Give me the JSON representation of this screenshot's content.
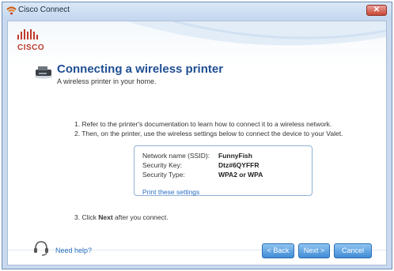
{
  "window": {
    "title": "Cisco Connect",
    "close_glyph": "✕"
  },
  "brand": {
    "logo_bars": "ılıılı",
    "name": "CISCO"
  },
  "header": {
    "title": "Connecting a wireless printer",
    "subtitle": "A wireless printer in your home."
  },
  "steps": [
    "1.  Refer to the printer's documentation to learn how to connect it to a wireless network.",
    "2.  Then, on the printer, use the wireless settings below to connect the device to your Valet."
  ],
  "step3": {
    "prefix": "3.  Click ",
    "bold": "Next",
    "suffix": " after you connect."
  },
  "settings": {
    "rows": [
      {
        "label": "Network name (SSID):",
        "value": "FunnyFish"
      },
      {
        "label": "Security Key:",
        "value": "Dtz#6QYFFR"
      },
      {
        "label": "Security Type:",
        "value": "WPA2 or WPA"
      }
    ],
    "print_link": "Print these settings"
  },
  "footer": {
    "help": "Need help?",
    "back": "< Back",
    "next": "Next >",
    "cancel": "Cancel"
  },
  "colors": {
    "accent": "#1f4f93",
    "link": "#2a6fc2",
    "button": "#3f8bd6",
    "brand_red": "#c0392b"
  },
  "icons": [
    "wifi-icon",
    "printer-icon",
    "headset-help-icon",
    "close-icon"
  ]
}
